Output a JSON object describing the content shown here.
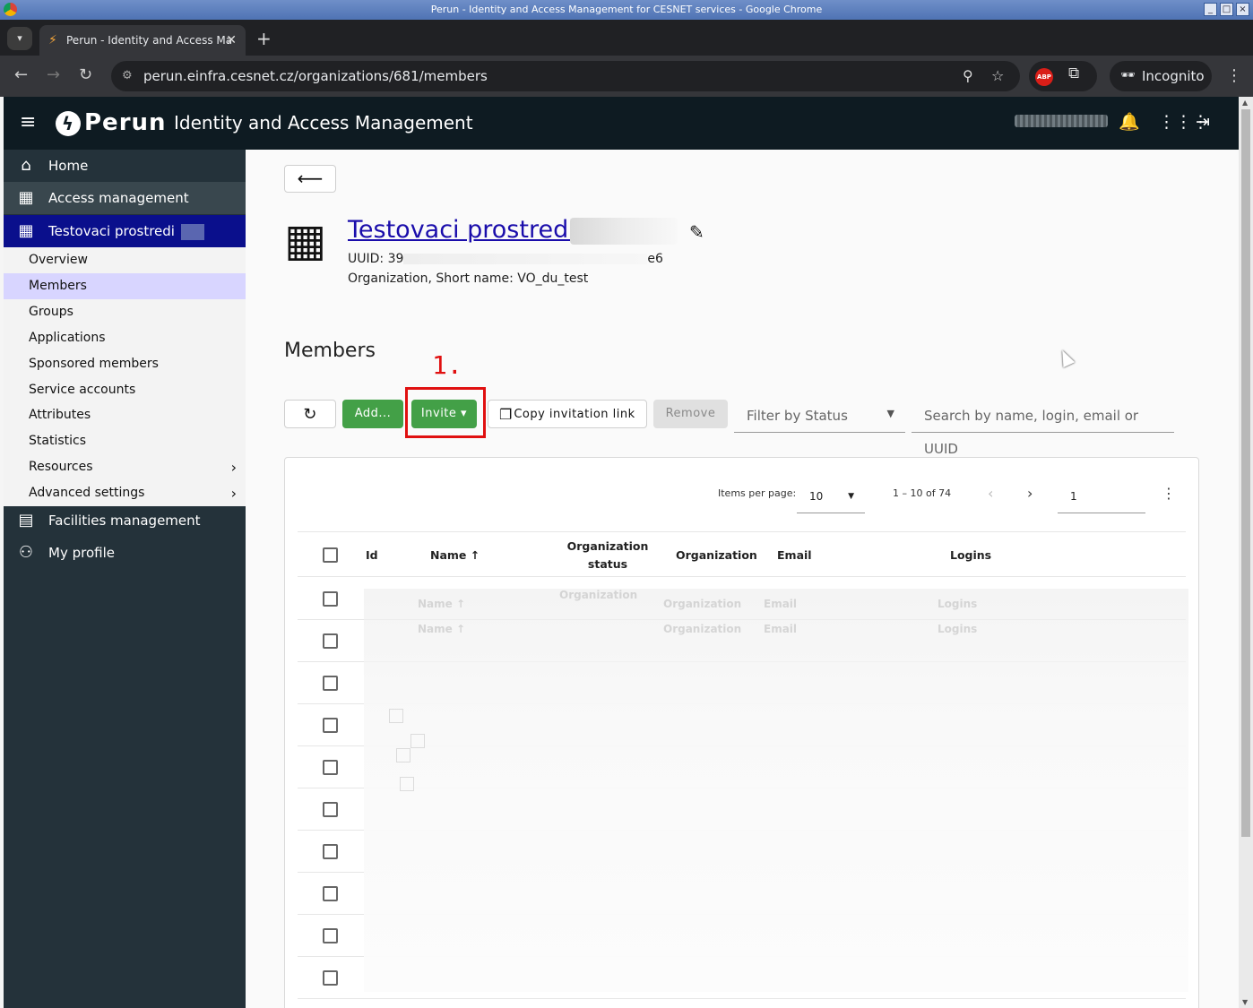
{
  "os": {
    "title": "Perun - Identity and Access Management for CESNET services - Google Chrome"
  },
  "browser": {
    "tab_title": "Perun - Identity and Access Ma",
    "url": "perun.einfra.cesnet.cz/organizations/681/members",
    "incognito_label": "Incognito",
    "abp_label": "ABP"
  },
  "header": {
    "brand": "Perun",
    "title": "Identity and Access Management"
  },
  "sidebar": {
    "items": [
      {
        "label": "Home",
        "icon": "home-icon"
      },
      {
        "label": "Access management",
        "icon": "building-icon"
      },
      {
        "label": "Testovaci prostredi",
        "icon": "building-icon"
      }
    ],
    "subitems": [
      "Overview",
      "Members",
      "Groups",
      "Applications",
      "Sponsored members",
      "Service accounts",
      "Attributes",
      "Statistics",
      "Resources",
      "Advanced settings"
    ],
    "bottom": [
      {
        "label": "Facilities management",
        "icon": "facility-icon"
      },
      {
        "label": "My profile",
        "icon": "user-icon"
      }
    ]
  },
  "org": {
    "name": "Testovaci prostredi",
    "uuid_prefix": "UUID: 39",
    "uuid_suffix": "e6",
    "shortname": "Organization, Short name: VO_du_test"
  },
  "members": {
    "heading": "Members",
    "annotation": "1.",
    "add_label": "Add...",
    "invite_label": "Invite ▾",
    "copy_label": "Copy invitation link",
    "remove_label": "Remove",
    "filter_status_placeholder": "Filter by Status",
    "search_placeholder": "Search by name, login, email or UUID"
  },
  "paginator": {
    "items_per_page_label": "Items per page:",
    "page_size": "10",
    "range": "1 – 10 of 74",
    "page": "1"
  },
  "table": {
    "columns": [
      "Id",
      "Name ↑",
      "Organization status",
      "Organization",
      "Email",
      "Logins"
    ],
    "row_count": 10
  },
  "colors": {
    "sidebar_bg": "#24323a",
    "sidebar_active": "#0a0f8c",
    "appbar_bg": "#0e1b22",
    "green": "#43a047",
    "annotation_red": "#e01010",
    "selected_sub": "#d8d5ff"
  }
}
